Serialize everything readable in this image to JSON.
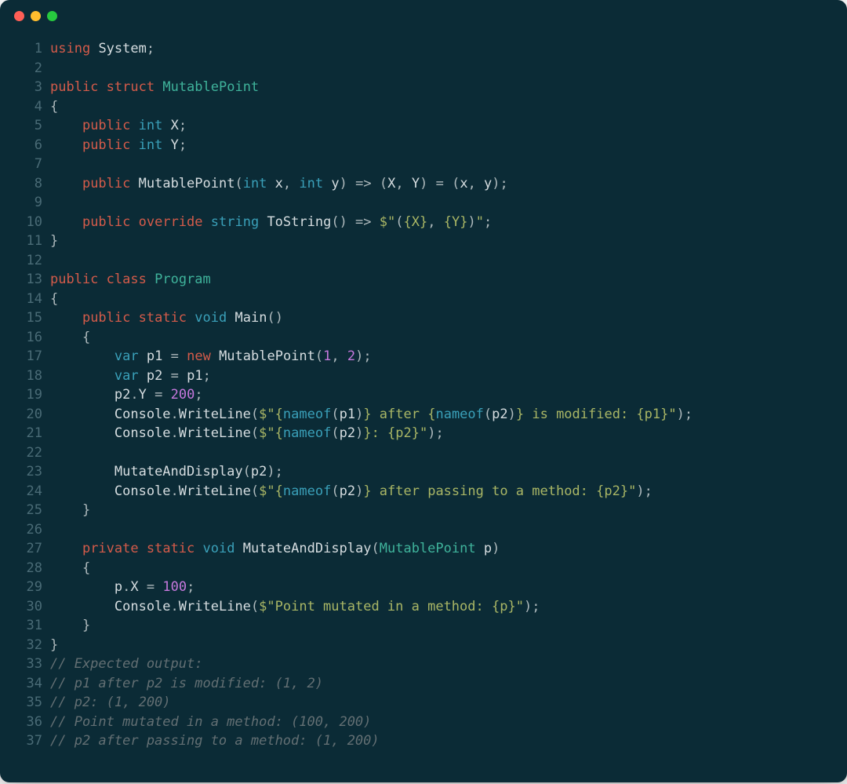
{
  "window": {
    "controls": [
      "close",
      "minimize",
      "zoom"
    ]
  },
  "code": {
    "language": "csharp",
    "line_count": 37,
    "lines": [
      {
        "n": 1,
        "tokens": [
          [
            "kw",
            "using"
          ],
          [
            "sp",
            " "
          ],
          [
            "id",
            "System"
          ],
          [
            "punct",
            ";"
          ]
        ]
      },
      {
        "n": 2,
        "tokens": []
      },
      {
        "n": 3,
        "tokens": [
          [
            "kw",
            "public"
          ],
          [
            "sp",
            " "
          ],
          [
            "kw",
            "struct"
          ],
          [
            "sp",
            " "
          ],
          [
            "type",
            "MutablePoint"
          ]
        ]
      },
      {
        "n": 4,
        "tokens": [
          [
            "punct",
            "{"
          ]
        ]
      },
      {
        "n": 5,
        "tokens": [
          [
            "sp",
            "    "
          ],
          [
            "kw",
            "public"
          ],
          [
            "sp",
            " "
          ],
          [
            "kw2",
            "int"
          ],
          [
            "sp",
            " "
          ],
          [
            "id",
            "X"
          ],
          [
            "punct",
            ";"
          ]
        ]
      },
      {
        "n": 6,
        "tokens": [
          [
            "sp",
            "    "
          ],
          [
            "kw",
            "public"
          ],
          [
            "sp",
            " "
          ],
          [
            "kw2",
            "int"
          ],
          [
            "sp",
            " "
          ],
          [
            "id",
            "Y"
          ],
          [
            "punct",
            ";"
          ]
        ]
      },
      {
        "n": 7,
        "tokens": []
      },
      {
        "n": 8,
        "tokens": [
          [
            "sp",
            "    "
          ],
          [
            "kw",
            "public"
          ],
          [
            "sp",
            " "
          ],
          [
            "fn",
            "MutablePoint"
          ],
          [
            "punct",
            "("
          ],
          [
            "kw2",
            "int"
          ],
          [
            "sp",
            " "
          ],
          [
            "id",
            "x"
          ],
          [
            "punct",
            ", "
          ],
          [
            "kw2",
            "int"
          ],
          [
            "sp",
            " "
          ],
          [
            "id",
            "y"
          ],
          [
            "punct",
            ") "
          ],
          [
            "op",
            "=>"
          ],
          [
            "sp",
            " "
          ],
          [
            "punct",
            "("
          ],
          [
            "id",
            "X"
          ],
          [
            "punct",
            ", "
          ],
          [
            "id",
            "Y"
          ],
          [
            "punct",
            ") "
          ],
          [
            "op",
            "="
          ],
          [
            "sp",
            " "
          ],
          [
            "punct",
            "("
          ],
          [
            "id",
            "x"
          ],
          [
            "punct",
            ", "
          ],
          [
            "id",
            "y"
          ],
          [
            "punct",
            ");"
          ]
        ]
      },
      {
        "n": 9,
        "tokens": []
      },
      {
        "n": 10,
        "tokens": [
          [
            "sp",
            "    "
          ],
          [
            "kw",
            "public"
          ],
          [
            "sp",
            " "
          ],
          [
            "kw",
            "override"
          ],
          [
            "sp",
            " "
          ],
          [
            "kw2",
            "string"
          ],
          [
            "sp",
            " "
          ],
          [
            "fn",
            "ToString"
          ],
          [
            "punct",
            "() "
          ],
          [
            "op",
            "=>"
          ],
          [
            "sp",
            " "
          ],
          [
            "str",
            "$\""
          ],
          [
            "punct",
            "("
          ],
          [
            "str",
            "{X}"
          ],
          [
            "punct",
            ", "
          ],
          [
            "str",
            "{Y}"
          ],
          [
            "punct",
            ")"
          ],
          [
            "str",
            "\""
          ],
          [
            "punct",
            ";"
          ]
        ]
      },
      {
        "n": 11,
        "tokens": [
          [
            "punct",
            "}"
          ]
        ]
      },
      {
        "n": 12,
        "tokens": []
      },
      {
        "n": 13,
        "tokens": [
          [
            "kw",
            "public"
          ],
          [
            "sp",
            " "
          ],
          [
            "kw",
            "class"
          ],
          [
            "sp",
            " "
          ],
          [
            "type",
            "Program"
          ]
        ]
      },
      {
        "n": 14,
        "tokens": [
          [
            "punct",
            "{"
          ]
        ]
      },
      {
        "n": 15,
        "tokens": [
          [
            "sp",
            "    "
          ],
          [
            "kw",
            "public"
          ],
          [
            "sp",
            " "
          ],
          [
            "kw",
            "static"
          ],
          [
            "sp",
            " "
          ],
          [
            "kw2",
            "void"
          ],
          [
            "sp",
            " "
          ],
          [
            "fn",
            "Main"
          ],
          [
            "punct",
            "()"
          ]
        ]
      },
      {
        "n": 16,
        "tokens": [
          [
            "sp",
            "    "
          ],
          [
            "punct",
            "{"
          ]
        ]
      },
      {
        "n": 17,
        "tokens": [
          [
            "sp",
            "        "
          ],
          [
            "kw2",
            "var"
          ],
          [
            "sp",
            " "
          ],
          [
            "id",
            "p1"
          ],
          [
            "sp",
            " "
          ],
          [
            "op",
            "="
          ],
          [
            "sp",
            " "
          ],
          [
            "kw",
            "new"
          ],
          [
            "sp",
            " "
          ],
          [
            "fn",
            "MutablePoint"
          ],
          [
            "punct",
            "("
          ],
          [
            "num",
            "1"
          ],
          [
            "punct",
            ", "
          ],
          [
            "num",
            "2"
          ],
          [
            "punct",
            ");"
          ]
        ]
      },
      {
        "n": 18,
        "tokens": [
          [
            "sp",
            "        "
          ],
          [
            "kw2",
            "var"
          ],
          [
            "sp",
            " "
          ],
          [
            "id",
            "p2"
          ],
          [
            "sp",
            " "
          ],
          [
            "op",
            "="
          ],
          [
            "sp",
            " "
          ],
          [
            "id",
            "p1"
          ],
          [
            "punct",
            ";"
          ]
        ]
      },
      {
        "n": 19,
        "tokens": [
          [
            "sp",
            "        "
          ],
          [
            "id",
            "p2"
          ],
          [
            "punct",
            "."
          ],
          [
            "id",
            "Y"
          ],
          [
            "sp",
            " "
          ],
          [
            "op",
            "="
          ],
          [
            "sp",
            " "
          ],
          [
            "num",
            "200"
          ],
          [
            "punct",
            ";"
          ]
        ]
      },
      {
        "n": 20,
        "tokens": [
          [
            "sp",
            "        "
          ],
          [
            "id",
            "Console"
          ],
          [
            "punct",
            "."
          ],
          [
            "fn",
            "WriteLine"
          ],
          [
            "punct",
            "("
          ],
          [
            "str",
            "$\""
          ],
          [
            "str",
            "{"
          ],
          [
            "kw2",
            "nameof"
          ],
          [
            "punct",
            "("
          ],
          [
            "id",
            "p1"
          ],
          [
            "punct",
            ")"
          ],
          [
            "str",
            "}"
          ],
          [
            "str",
            " after "
          ],
          [
            "str",
            "{"
          ],
          [
            "kw2",
            "nameof"
          ],
          [
            "punct",
            "("
          ],
          [
            "id",
            "p2"
          ],
          [
            "punct",
            ")"
          ],
          [
            "str",
            "}"
          ],
          [
            "str",
            " is modified: "
          ],
          [
            "str",
            "{p1}"
          ],
          [
            "str",
            "\""
          ],
          [
            "punct",
            ");"
          ]
        ]
      },
      {
        "n": 21,
        "tokens": [
          [
            "sp",
            "        "
          ],
          [
            "id",
            "Console"
          ],
          [
            "punct",
            "."
          ],
          [
            "fn",
            "WriteLine"
          ],
          [
            "punct",
            "("
          ],
          [
            "str",
            "$\""
          ],
          [
            "str",
            "{"
          ],
          [
            "kw2",
            "nameof"
          ],
          [
            "punct",
            "("
          ],
          [
            "id",
            "p2"
          ],
          [
            "punct",
            ")"
          ],
          [
            "str",
            "}"
          ],
          [
            "str",
            ": "
          ],
          [
            "str",
            "{p2}"
          ],
          [
            "str",
            "\""
          ],
          [
            "punct",
            ");"
          ]
        ]
      },
      {
        "n": 22,
        "tokens": []
      },
      {
        "n": 23,
        "tokens": [
          [
            "sp",
            "        "
          ],
          [
            "fn",
            "MutateAndDisplay"
          ],
          [
            "punct",
            "("
          ],
          [
            "id",
            "p2"
          ],
          [
            "punct",
            ");"
          ]
        ]
      },
      {
        "n": 24,
        "tokens": [
          [
            "sp",
            "        "
          ],
          [
            "id",
            "Console"
          ],
          [
            "punct",
            "."
          ],
          [
            "fn",
            "WriteLine"
          ],
          [
            "punct",
            "("
          ],
          [
            "str",
            "$\""
          ],
          [
            "str",
            "{"
          ],
          [
            "kw2",
            "nameof"
          ],
          [
            "punct",
            "("
          ],
          [
            "id",
            "p2"
          ],
          [
            "punct",
            ")"
          ],
          [
            "str",
            "}"
          ],
          [
            "str",
            " after passing to a method: "
          ],
          [
            "str",
            "{p2}"
          ],
          [
            "str",
            "\""
          ],
          [
            "punct",
            ");"
          ]
        ]
      },
      {
        "n": 25,
        "tokens": [
          [
            "sp",
            "    "
          ],
          [
            "punct",
            "}"
          ]
        ]
      },
      {
        "n": 26,
        "tokens": []
      },
      {
        "n": 27,
        "tokens": [
          [
            "sp",
            "    "
          ],
          [
            "kw",
            "private"
          ],
          [
            "sp",
            " "
          ],
          [
            "kw",
            "static"
          ],
          [
            "sp",
            " "
          ],
          [
            "kw2",
            "void"
          ],
          [
            "sp",
            " "
          ],
          [
            "fn",
            "MutateAndDisplay"
          ],
          [
            "punct",
            "("
          ],
          [
            "type",
            "MutablePoint"
          ],
          [
            "sp",
            " "
          ],
          [
            "id",
            "p"
          ],
          [
            "punct",
            ")"
          ]
        ]
      },
      {
        "n": 28,
        "tokens": [
          [
            "sp",
            "    "
          ],
          [
            "punct",
            "{"
          ]
        ]
      },
      {
        "n": 29,
        "tokens": [
          [
            "sp",
            "        "
          ],
          [
            "id",
            "p"
          ],
          [
            "punct",
            "."
          ],
          [
            "id",
            "X"
          ],
          [
            "sp",
            " "
          ],
          [
            "op",
            "="
          ],
          [
            "sp",
            " "
          ],
          [
            "num",
            "100"
          ],
          [
            "punct",
            ";"
          ]
        ]
      },
      {
        "n": 30,
        "tokens": [
          [
            "sp",
            "        "
          ],
          [
            "id",
            "Console"
          ],
          [
            "punct",
            "."
          ],
          [
            "fn",
            "WriteLine"
          ],
          [
            "punct",
            "("
          ],
          [
            "str",
            "$\"Point mutated in a method: "
          ],
          [
            "str",
            "{p}"
          ],
          [
            "str",
            "\""
          ],
          [
            "punct",
            ");"
          ]
        ]
      },
      {
        "n": 31,
        "tokens": [
          [
            "sp",
            "    "
          ],
          [
            "punct",
            "}"
          ]
        ]
      },
      {
        "n": 32,
        "tokens": [
          [
            "punct",
            "}"
          ]
        ]
      },
      {
        "n": 33,
        "tokens": [
          [
            "cmt",
            "// Expected output:"
          ]
        ]
      },
      {
        "n": 34,
        "tokens": [
          [
            "cmt",
            "// p1 after p2 is modified: (1, 2)"
          ]
        ]
      },
      {
        "n": 35,
        "tokens": [
          [
            "cmt",
            "// p2: (1, 200)"
          ]
        ]
      },
      {
        "n": 36,
        "tokens": [
          [
            "cmt",
            "// Point mutated in a method: (100, 200)"
          ]
        ]
      },
      {
        "n": 37,
        "tokens": [
          [
            "cmt",
            "// p2 after passing to a method: (1, 200)"
          ]
        ]
      }
    ]
  }
}
